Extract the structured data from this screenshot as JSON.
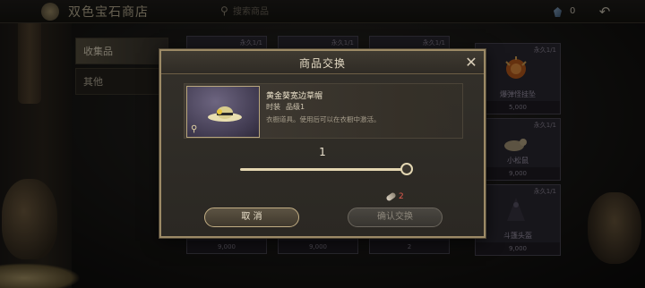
{
  "header": {
    "title": "双色宝石商店",
    "search_placeholder": "搜索商品",
    "currency_value": "0"
  },
  "tabs": [
    {
      "label": "收集品",
      "active": true
    },
    {
      "label": "其他",
      "active": false
    }
  ],
  "grid": {
    "cards": [
      {
        "limit": "永久1/1",
        "name": "",
        "price": ""
      },
      {
        "limit": "永久1/1",
        "name": "",
        "price": ""
      },
      {
        "limit": "永久1/1",
        "name": "",
        "price": ""
      },
      {
        "limit": "永久1/1",
        "name": "爆弹怪挂坠",
        "price": "5,000"
      },
      {
        "limit": "永久1/1",
        "name": "小松鼠",
        "price": "9,000"
      },
      {
        "limit": "永久1/1",
        "name": "斗篷头盔",
        "price": "9,000"
      },
      {
        "limit": "",
        "name": "",
        "price": "9,000"
      },
      {
        "limit": "",
        "name": "",
        "price": "9,000"
      },
      {
        "limit": "",
        "name": "",
        "price": "2"
      }
    ]
  },
  "modal": {
    "title": "商品交换",
    "item": {
      "name": "黄金葵宽边草帽",
      "type": "时装",
      "grade": "品级1",
      "description": "衣橱道具。使用后可以在衣橱中激活。"
    },
    "quantity": "1",
    "slider_fraction": 1.0,
    "cost": "2",
    "cancel_label": "取 消",
    "confirm_label": "确认交换"
  },
  "colors": {
    "accent_gold": "#c2ae84",
    "cost_red": "#e05b4e"
  }
}
